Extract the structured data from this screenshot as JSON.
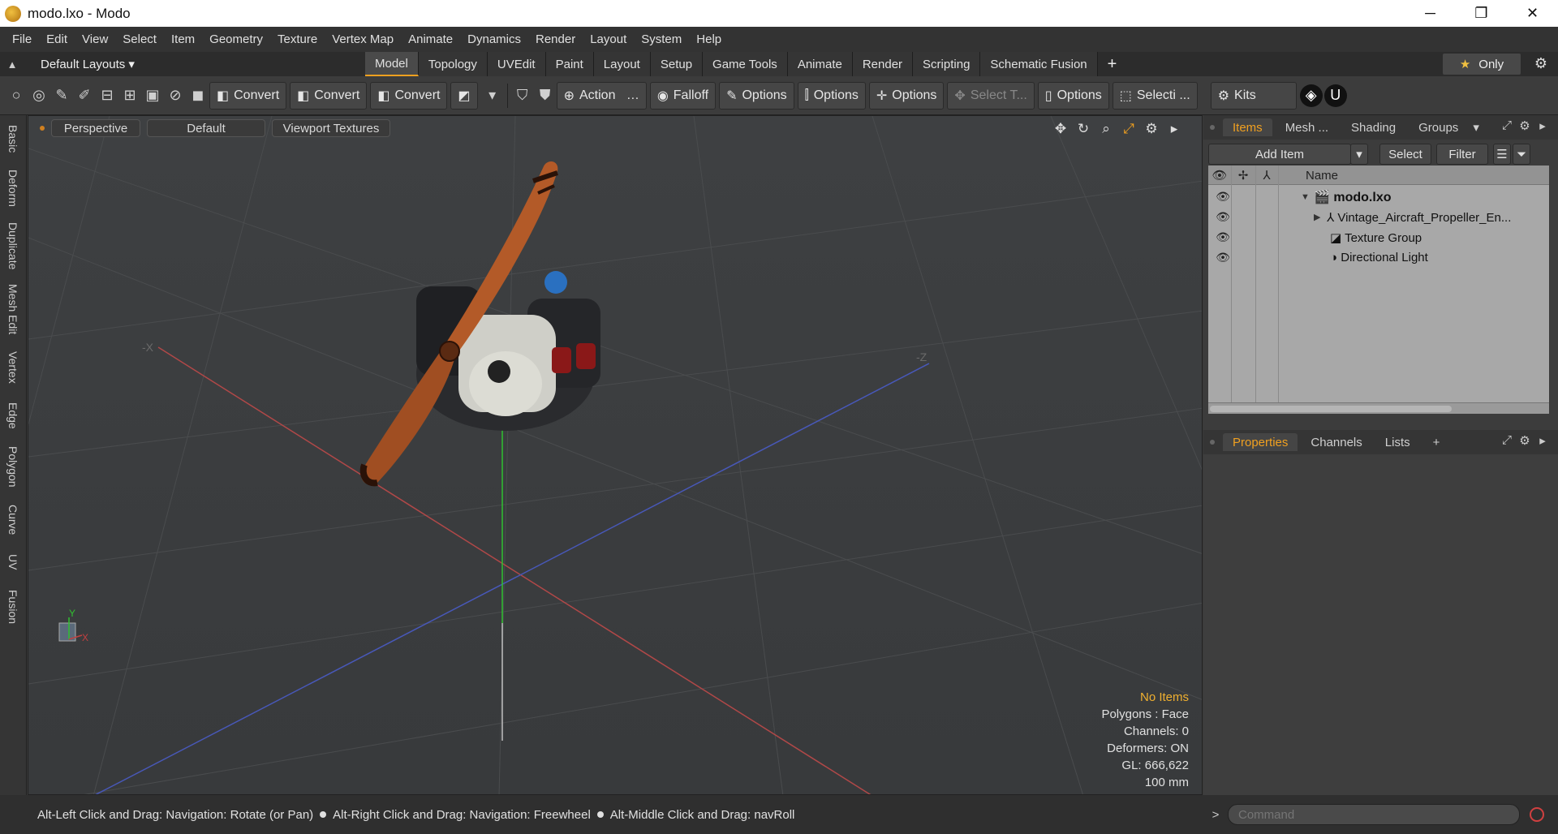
{
  "window": {
    "title": "modo.lxo - Modo",
    "minimize": "─",
    "restore": "❐",
    "close": "✕"
  },
  "menu": [
    "File",
    "Edit",
    "View",
    "Select",
    "Item",
    "Geometry",
    "Texture",
    "Vertex Map",
    "Animate",
    "Dynamics",
    "Render",
    "Layout",
    "System",
    "Help"
  ],
  "layoutbar": {
    "layouts_label": "Default Layouts ▾",
    "tabs": [
      "Model",
      "Topology",
      "UVEdit",
      "Paint",
      "Layout",
      "Setup",
      "Game Tools",
      "Animate",
      "Render",
      "Scripting",
      "Schematic Fusion"
    ],
    "active_tab": "Model",
    "add": "+",
    "only_label": "Only"
  },
  "toolbar": {
    "convert1": "Convert",
    "convert2": "Convert",
    "convert3": "Convert",
    "action": "Action",
    "action_more": "…",
    "falloff": "Falloff",
    "options1": "Options",
    "options2": "Options",
    "options3": "Options",
    "select_t": "Select T...",
    "options4": "Options",
    "selecti": "Selecti ...",
    "kits": "Kits"
  },
  "left_tabs": [
    "Basic",
    "Deform",
    "Duplicate",
    "Mesh Edit",
    "Vertex",
    "Edge",
    "Polygon",
    "Curve",
    "UV",
    "Fusion"
  ],
  "viewport": {
    "view": "Perspective",
    "shading": "Default",
    "textures": "Viewport Textures",
    "axis_x_label": "-X",
    "axis_z_label": "-Z",
    "gizmo_y": "Y",
    "gizmo_x": "X",
    "info": {
      "no_items": "No Items",
      "polygons": "Polygons : Face",
      "channels": "Channels: 0",
      "deformers": "Deformers: ON",
      "gl": "GL: 666,622",
      "scale": "100 mm"
    }
  },
  "items_panel": {
    "tabs": [
      "Items",
      "Mesh ...",
      "Shading",
      "Groups"
    ],
    "active_tab": "Items",
    "add_item": "Add Item",
    "select": "Select",
    "filter": "Filter",
    "column_name": "Name",
    "rows": [
      {
        "name": "modo.lxo"
      },
      {
        "name": "Vintage_Aircraft_Propeller_En..."
      },
      {
        "name": "Texture Group"
      },
      {
        "name": "Directional Light"
      }
    ]
  },
  "properties_panel": {
    "tabs": [
      "Properties",
      "Channels",
      "Lists"
    ],
    "active_tab": "Properties",
    "add": "+"
  },
  "status": {
    "hint1": "Alt-Left Click and Drag: Navigation: Rotate (or Pan)",
    "hint2": "Alt-Right Click and Drag: Navigation: Freewheel",
    "hint3": "Alt-Middle Click and Drag: navRoll"
  },
  "command": {
    "prompt": ">",
    "placeholder": "Command"
  },
  "colors": {
    "accent": "#f0a020",
    "viewport_bg": "#3c3e40",
    "axis_red": "#c04040",
    "axis_blue": "#4050c0",
    "axis_green": "#30c030"
  }
}
